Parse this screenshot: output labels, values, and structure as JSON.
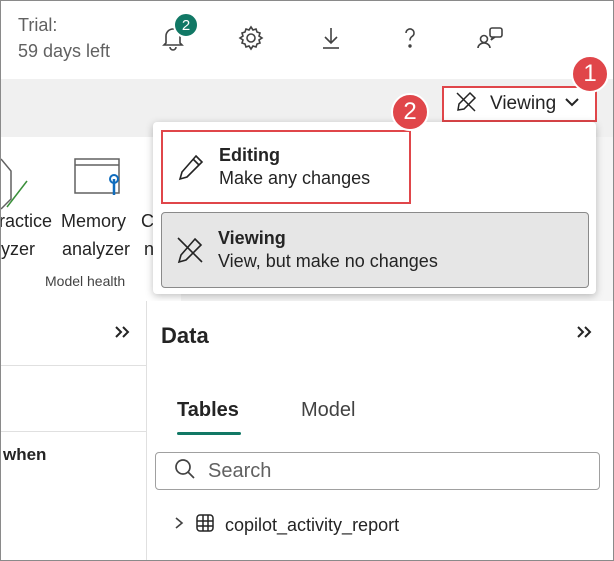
{
  "header": {
    "trial_line1": "Trial:",
    "trial_line2": "59 days left",
    "notifications_count": "2",
    "icons": [
      "bell-icon",
      "gear-icon",
      "download-icon",
      "help-icon",
      "feedback-icon"
    ]
  },
  "mode_button": {
    "label": "Viewing",
    "icon": "pencil-slash-icon"
  },
  "callouts": {
    "one": "1",
    "two": "2"
  },
  "ribbon": {
    "partial_item_line1": "ractice",
    "partial_item_line2": "yzer",
    "memory_line1": "Memory",
    "memory_line2": "analyzer",
    "partial_right_line1": "Co",
    "partial_right_line2": "n",
    "group_label": "Model health"
  },
  "menu": {
    "items": [
      {
        "title": "Editing",
        "subtitle": "Make any changes",
        "icon": "pencil-icon"
      },
      {
        "title": "Viewing",
        "subtitle": "View, but make no changes",
        "icon": "pencil-slash-icon"
      }
    ]
  },
  "left_pane": {
    "partial_text": "when"
  },
  "data_pane": {
    "title": "Data",
    "tabs": [
      {
        "label": "Tables"
      },
      {
        "label": "Model"
      }
    ],
    "search_placeholder": "Search",
    "tree": [
      {
        "label": "copilot_activity_report",
        "icon": "table-icon"
      }
    ]
  },
  "colors": {
    "accent": "#117865",
    "highlight_red": "#e0464a"
  }
}
